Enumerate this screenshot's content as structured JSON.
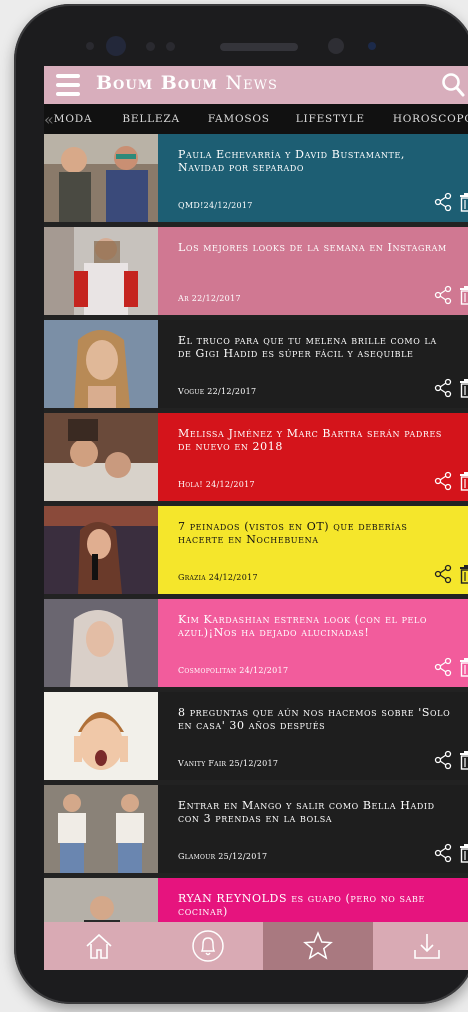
{
  "app": {
    "brand_bold": "Boum Boum",
    "brand_light": "News",
    "brand_color": "#d8aebc"
  },
  "categories": [
    "MODA",
    "BELLEZA",
    "FAMOSOS",
    "LIFESTYLE",
    "HOROSCOPO"
  ],
  "articles": [
    {
      "title": "Paula Echevarría y David Bustamante, Navidad por separado",
      "meta": "QMD!24/12/2017",
      "bg": "#1d5e73"
    },
    {
      "title": "Los mejores looks de la semana en Instagram",
      "meta": "Ar 22/12/2017",
      "bg": "#d07892"
    },
    {
      "title": "El truco para que tu melena brille como la de Gigi Hadid es súper fácil y asequible",
      "meta": "Vogue 22/12/2017",
      "bg": "#1e1e1e"
    },
    {
      "title": "Melissa Jiménez y Marc Bartra serán padres de nuevo en 2018",
      "meta": "Hola! 24/12/2017",
      "bg": "#d4141b"
    },
    {
      "title": "7 peinados (vistos en OT) que deberías hacerte en Nochebuena",
      "meta": "Grazia 24/12/2017",
      "bg": "#f5e62b"
    },
    {
      "title": "Kim Kardashian estrena look (con el pelo azul)¡Nos ha dejado alucinadas!",
      "meta": "Cosmopolitan 24/12/2017",
      "bg": "#f25c9c"
    },
    {
      "title": "8 preguntas que aún nos hacemos sobre 'Solo en casa' 30 años después",
      "meta": "Vanity Fair 25/12/2017",
      "bg": "#1e1e1e"
    },
    {
      "title": "Entrar en Mango y salir como Bella Hadid con 3 prendas en la bolsa",
      "meta": "Glamour 25/12/2017",
      "bg": "#1e1e1e"
    },
    {
      "title": "RYAN REYNOLDS es guapo (pero no sabe cocinar)",
      "meta": "",
      "bg": "#e6147e"
    }
  ],
  "nav": [
    "home-icon",
    "bell-icon",
    "star-icon",
    "download-icon"
  ]
}
